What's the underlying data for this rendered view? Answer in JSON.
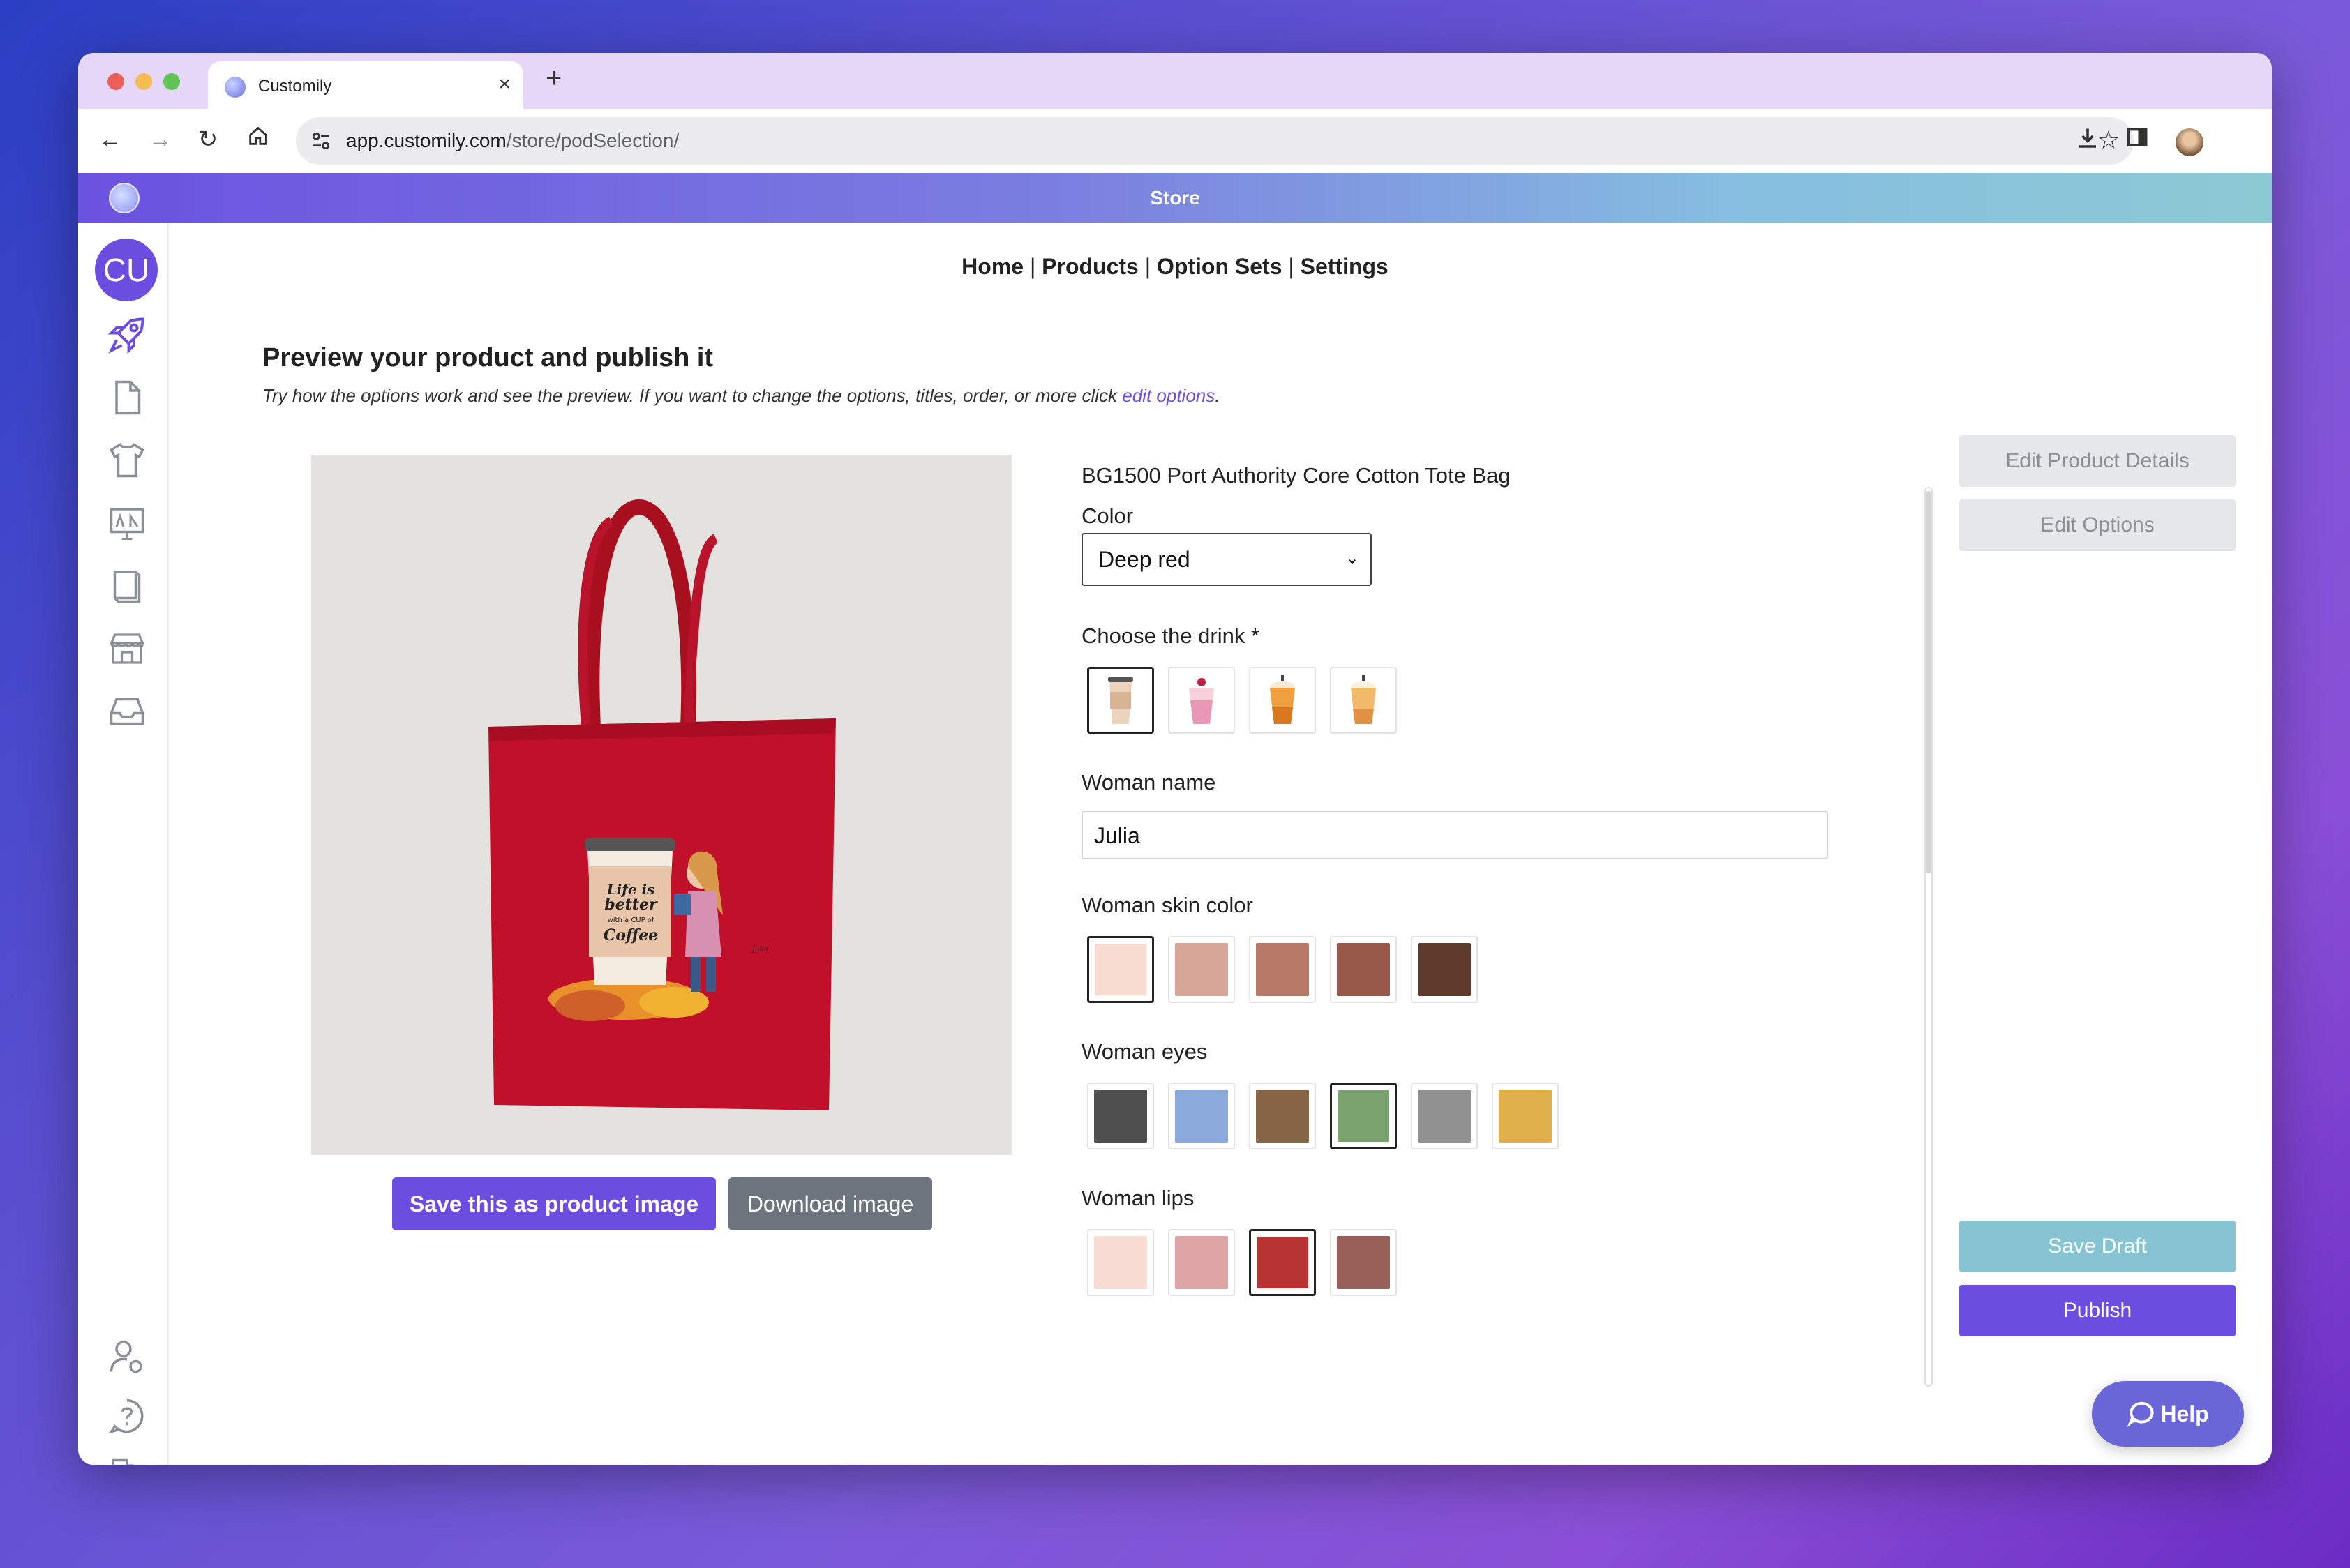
{
  "browser": {
    "tab_title": "Customily",
    "tab_close": "×",
    "new_tab": "+",
    "url_host": "app.customily.com",
    "url_path": "/store/podSelection/"
  },
  "store_header": {
    "title": "Store"
  },
  "sidebar": {
    "avatar_initials": "CU",
    "icons": [
      "rocket-icon",
      "document-icon",
      "tshirt-icon",
      "monitor-icon",
      "book-icon",
      "store-icon",
      "inbox-icon",
      "user-settings-icon",
      "help-circle-icon",
      "logout-icon"
    ]
  },
  "topnav": {
    "home": "Home",
    "products": "Products",
    "option_sets": "Option Sets",
    "settings": "Settings",
    "separator": "|"
  },
  "page": {
    "heading": "Preview your product and publish it",
    "subtext_before": "Try how the options work and see the preview. If you want to change the options, titles, order, or more click ",
    "subtext_link": "edit options",
    "subtext_after": "."
  },
  "preview": {
    "design_text_1": "Life is",
    "design_text_2": "better",
    "design_text_3": "with a CUP of",
    "design_text_4": "Coffee",
    "design_name": "Julia",
    "save_image_button": "Save this as product image",
    "download_button": "Download image"
  },
  "options": {
    "product_name": "BG1500 Port Authority Core Cotton Tote Bag",
    "color_label": "Color",
    "color_value": "Deep red",
    "drink_label": "Choose the drink *",
    "drinks": [
      "coffee-cup-icon",
      "pink-milkshake-icon",
      "orange-iced-drink-icon",
      "caramel-iced-drink-icon"
    ],
    "name_label": "Woman name",
    "name_value": "Julia",
    "skin_label": "Woman skin color",
    "skin_colors": [
      "#f8dcd2",
      "#d6a699",
      "#b87868",
      "#98584a",
      "#5e3a2c"
    ],
    "eyes_label": "Woman eyes",
    "eye_colors": [
      "#4f4f4f",
      "#8aaadc",
      "#866446",
      "#7aa26e",
      "#909090",
      "#e0b04a"
    ],
    "lips_label": "Woman lips",
    "lip_colors": [
      "#f8dcd4",
      "#dca4a4",
      "#b83432",
      "#966058"
    ]
  },
  "actions": {
    "edit_product_details": "Edit Product Details",
    "edit_options": "Edit Options",
    "save_draft": "Save Draft",
    "publish": "Publish",
    "help": "Help"
  },
  "colors": {
    "accent": "#6b4ee0",
    "teal": "#86c4d4",
    "bag_red": "#c0102a"
  }
}
